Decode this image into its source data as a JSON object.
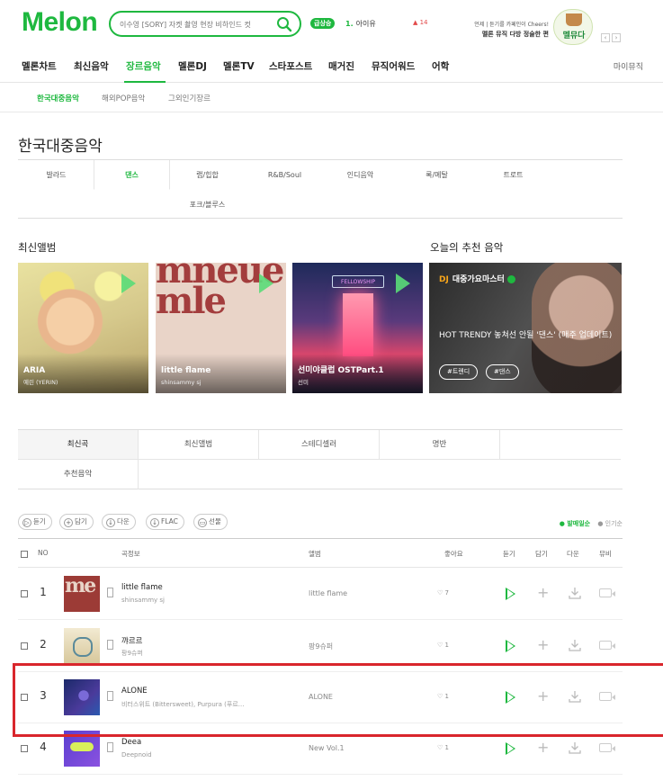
{
  "header": {
    "logo": "Melon",
    "search_placeholder": "이수영 [SORY] 자켓 촬영 현장 비하인드 컷",
    "realtime_badge": "급상승",
    "realtime_rank": "1.",
    "realtime_title": "아이유",
    "realtime_change": "▲ 14",
    "promo_line1": "언제 | 듣기를 카페인이 Cheers!",
    "promo_line2": "멜론 뮤직 다방 정술한 편",
    "promo_logo": "멜뮤다"
  },
  "gnb": {
    "items": [
      "멜론차트",
      "최신음악",
      "장르음악",
      "멜론DJ",
      "멜론TV",
      "스타포스트",
      "매거진",
      "뮤직어워드",
      "어학"
    ],
    "active": "장르음악",
    "my": "마이뮤직"
  },
  "snb": {
    "items": [
      "한국대중음악",
      "해외POP음악",
      "그외인기장르"
    ],
    "active": "한국대중음악"
  },
  "page_title": "한국대중음악",
  "genres": {
    "row1": [
      "발라드",
      "댄스",
      "랩/힙합",
      "R&B/Soul",
      "인디음악",
      "록/메탈",
      "트로트"
    ],
    "row2": [
      "포크/블루스"
    ],
    "active": "댄스"
  },
  "new_albums": {
    "title": "최신앨범",
    "items": [
      {
        "title": "ARIA",
        "artist": "예린 (YERIN)"
      },
      {
        "title": "little flame",
        "artist": "shinsammy sj"
      },
      {
        "title": "선미야클럽 OSTPart.1",
        "artist": "선미",
        "sign": "FELLOWSHIP"
      }
    ]
  },
  "recommend": {
    "title": "오늘의 추천 음악",
    "dj_label": "DJ",
    "dj_name": "대중가요마스터",
    "description": "HOT TRENDY 놓쳐선 안될 '댄스' (매주 업데이트)",
    "tags": [
      "#트렌디",
      "#댄스"
    ]
  },
  "chart_tabs": {
    "row1": [
      "최신곡",
      "최신앨범",
      "스테디셀러",
      "명반"
    ],
    "row2": [
      "추천음악"
    ],
    "active": "최신곡"
  },
  "toolbar": {
    "buttons": [
      {
        "icon": "▷",
        "label": "듣기"
      },
      {
        "icon": "+",
        "label": "담기"
      },
      {
        "icon": "↓",
        "label": "다운"
      },
      {
        "icon": "↓",
        "label": "FLAC"
      },
      {
        "icon": "▭",
        "label": "선물"
      }
    ],
    "sort_active": "● 발매일순",
    "sort_other": "● 인기순"
  },
  "table": {
    "headers": {
      "no": "NO",
      "song": "곡정보",
      "album": "앨범",
      "like": "좋아요",
      "play": "듣기",
      "add": "담기",
      "download": "다운",
      "mv": "뮤비"
    },
    "rows": [
      {
        "rank": "1",
        "title": "little flame",
        "artist": "shinsammy sj",
        "album": "little flame",
        "likes": "♡ 7"
      },
      {
        "rank": "2",
        "title": "꺄르르",
        "artist": "팡9슈퍼",
        "album": "팡9슈퍼",
        "likes": "♡ 1"
      },
      {
        "rank": "3",
        "title": "ALONE",
        "artist": "비터스위트 (Bittersweet), Purpura (푸르...",
        "album": "ALONE",
        "likes": "♡ 1"
      },
      {
        "rank": "4",
        "title": "Deea",
        "artist": "Deepnoid",
        "album": "New Vol.1",
        "likes": "♡ 1"
      }
    ]
  },
  "colors": {
    "brand": "#1eb83f",
    "highlight": "#d9262c"
  }
}
